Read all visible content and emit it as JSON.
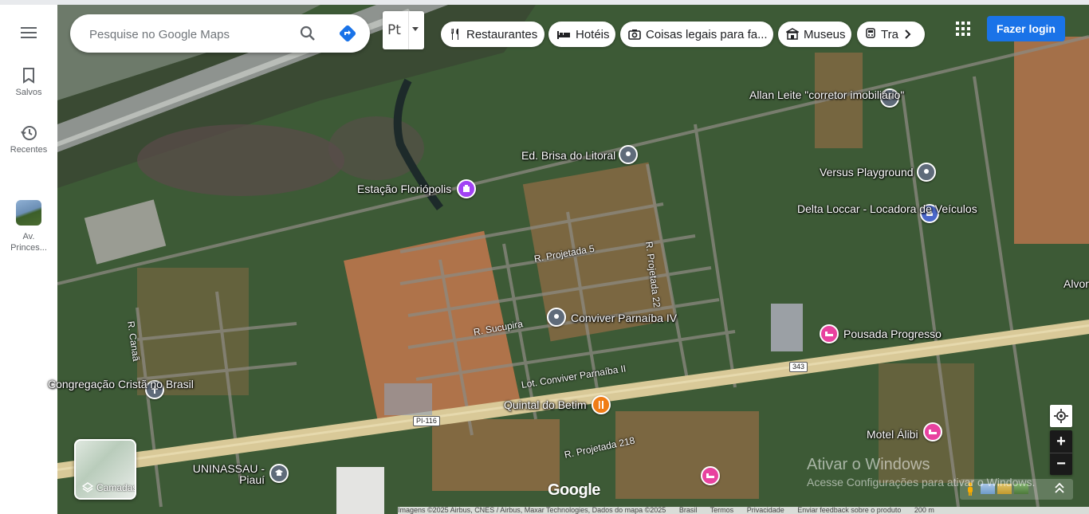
{
  "sidebar": {
    "menu_icon": "hamburger-menu-icon",
    "saved_label": "Salvos",
    "recents_label": "Recentes",
    "recent_place_label": "Av. Princes..."
  },
  "search": {
    "placeholder": "Pesquise no Google Maps",
    "search_icon": "search-icon",
    "directions_icon": "directions-icon"
  },
  "language_picker": {
    "code": "Pt"
  },
  "chips": [
    {
      "label": "Restaurantes",
      "icon": "fork-knife-icon"
    },
    {
      "label": "Hotéis",
      "icon": "bed-icon"
    },
    {
      "label": "Coisas legais para fa...",
      "icon": "camera-icon"
    },
    {
      "label": "Museus",
      "icon": "museum-icon"
    },
    {
      "label": "Tra",
      "icon": "train-icon"
    }
  ],
  "header": {
    "login_label": "Fazer login",
    "apps_icon": "apps-grid-icon"
  },
  "places": {
    "allan": "Allan Leite \"corretor imobiliário\"",
    "brisa": "Ed. Brisa do Litoral",
    "versus": "Versus Playground",
    "estacao": "Estação Floriópolis",
    "delta": "Delta Loccar - Locadora de Veículos",
    "conviver": "Conviver Parnaíba IV",
    "pousada": "Pousada Progresso",
    "congregacao": "Congregação Cristã no Brasil",
    "quintal": "Quintal do Betim",
    "motel": "Motel Álibi",
    "uninassau": "UNINASSAU - Piauí",
    "alvor": "Alvor"
  },
  "roads": {
    "projetada5": "R. Projetada 5",
    "projetada22": "R. Projetada 22",
    "sucupira": "R. Sucupira",
    "lot_conviver": "Lot. Conviver Parnaíba II",
    "projetada218": "R. Projetada 218",
    "canaa": "R. Canaã",
    "shield_343": "343",
    "shield_pi116": "PI-116"
  },
  "map_controls": {
    "layers_label": "Camadas",
    "layers_icon": "layers-icon",
    "locate_icon": "my-location-icon",
    "zoom_in": "+",
    "zoom_out": "−"
  },
  "branding": {
    "google": "Google"
  },
  "watermark": {
    "line1": "Ativar o Windows",
    "line2": "Acesse Configurações para ativar o Windows."
  },
  "attribution": {
    "imagery": "Imagens ©2025 Airbus, CNES / Airbus, Maxar Technologies, Dados do mapa ©2025",
    "country": "Brasil",
    "terms": "Termos",
    "privacy": "Privacidade",
    "feedback": "Enviar feedback sobre o produto",
    "scale": "200 m"
  },
  "colors": {
    "accent": "#1a73e8",
    "pin_gray": "#5f6b7a",
    "pin_purple": "#a142f4",
    "pin_pink": "#e8429f",
    "pin_orange": "#f07c15",
    "pin_blue": "#4a67c9",
    "highway": "#d9c998"
  }
}
